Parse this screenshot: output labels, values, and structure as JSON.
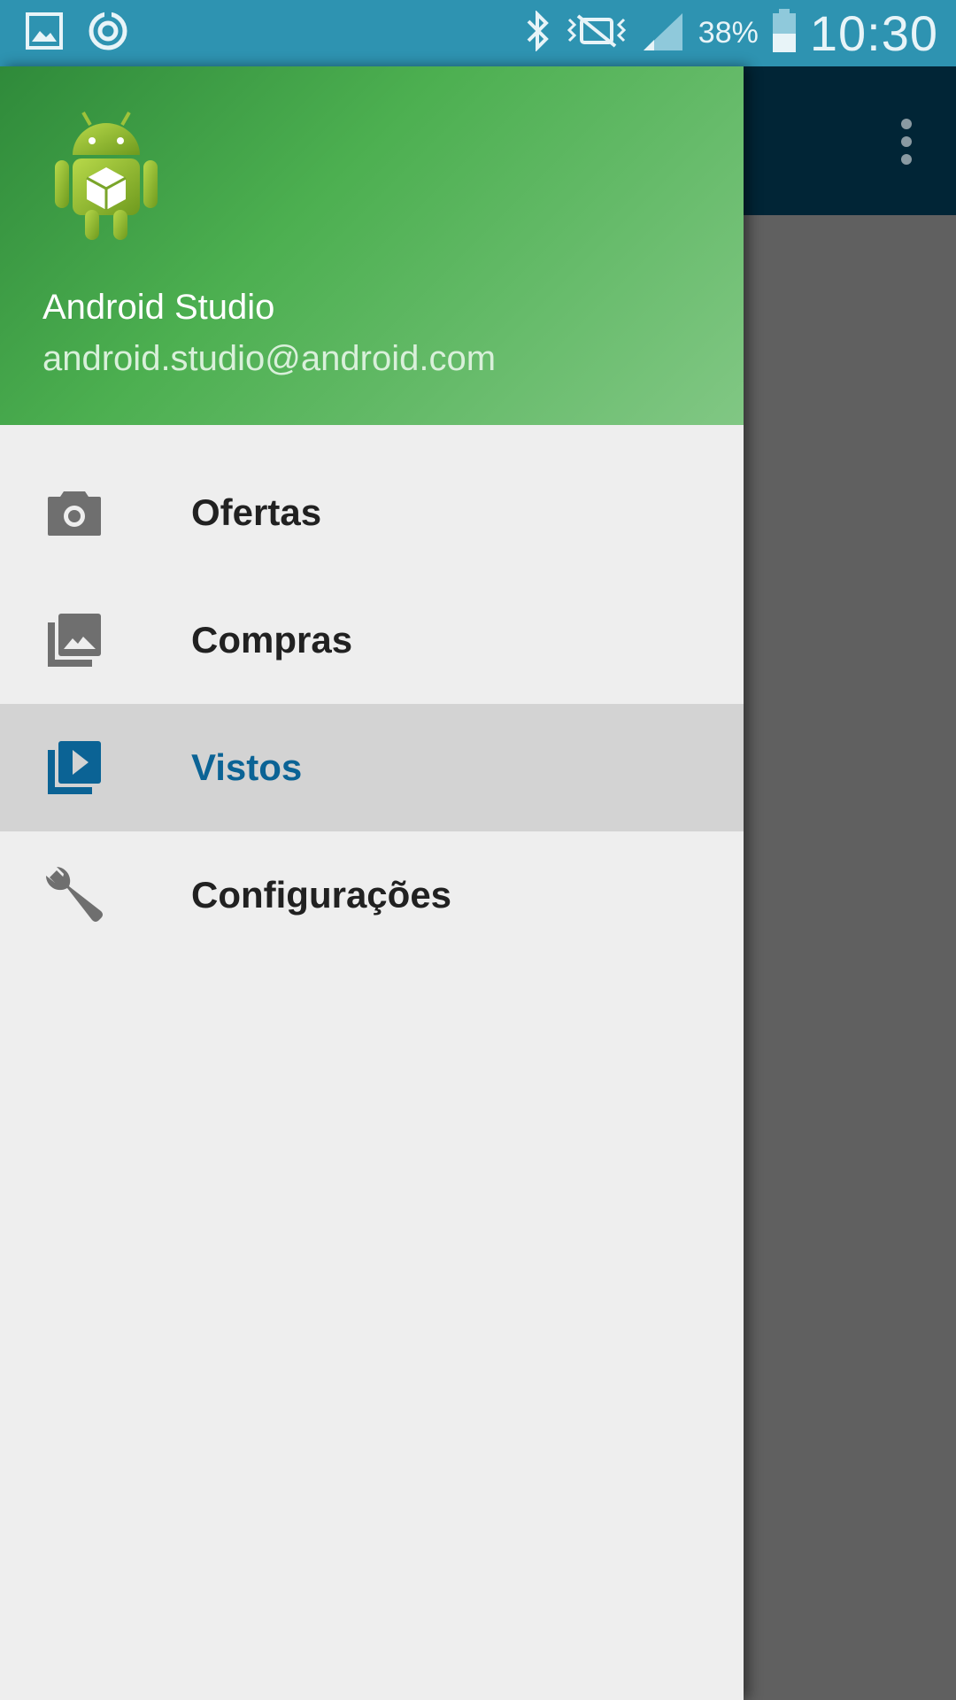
{
  "status_bar": {
    "battery_percent": "38%",
    "time": "10:30",
    "icons": [
      "gallery-notification-icon",
      "sync-notification-icon",
      "bluetooth-icon",
      "vibrate-mute-icon",
      "signal-icon",
      "battery-icon"
    ]
  },
  "toolbar": {
    "overflow_icon": "more-vert-icon"
  },
  "drawer": {
    "header": {
      "name": "Android Studio",
      "email": "android.studio@android.com",
      "avatar_icon": "android-robot-icon"
    },
    "items": [
      {
        "label": "Ofertas",
        "icon": "camera-icon",
        "selected": false
      },
      {
        "label": "Compras",
        "icon": "photo-library-icon",
        "selected": false
      },
      {
        "label": "Vistos",
        "icon": "video-library-icon",
        "selected": true
      },
      {
        "label": "Configurações",
        "icon": "wrench-icon",
        "selected": false
      }
    ]
  },
  "colors": {
    "status_bar": "#2e93b1",
    "toolbar": "#012536",
    "header_green": "#4caf50",
    "selected_text": "#0b6395",
    "icon_gray": "#6f6f6f"
  }
}
